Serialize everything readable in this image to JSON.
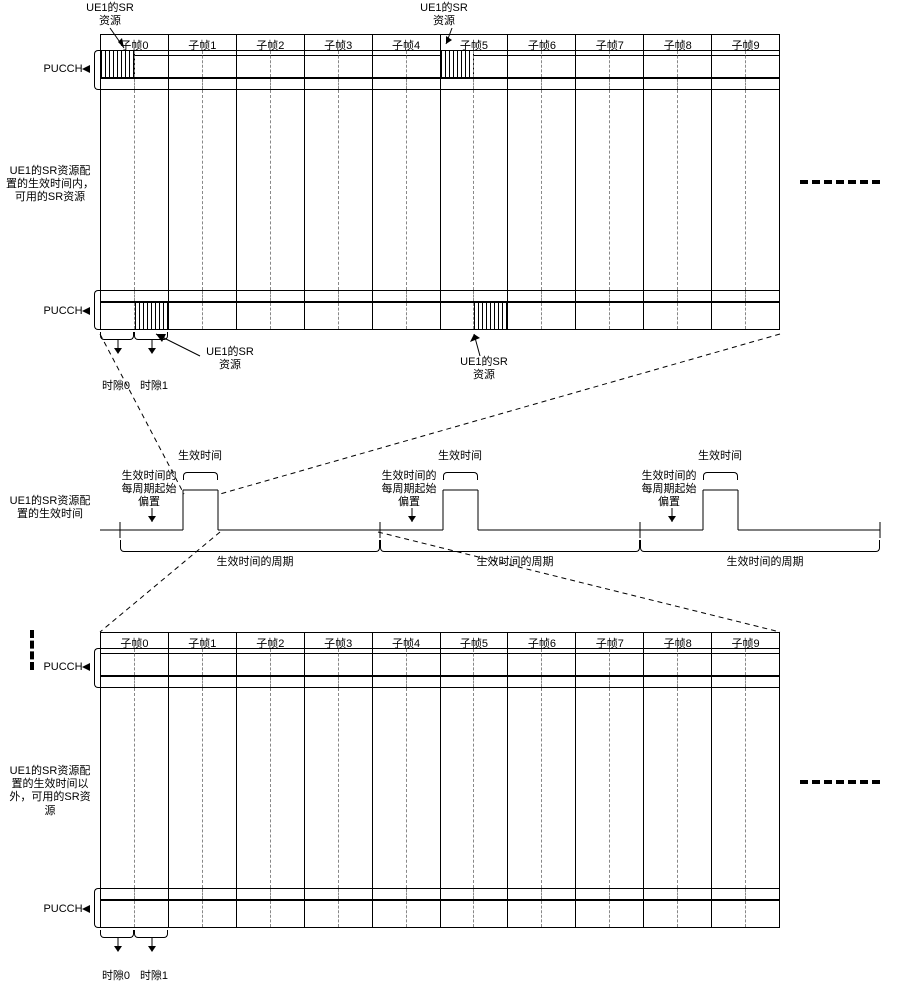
{
  "subframes": [
    "子帧0",
    "子帧1",
    "子帧2",
    "子帧3",
    "子帧4",
    "子帧5",
    "子帧6",
    "子帧7",
    "子帧8",
    "子帧9"
  ],
  "labels": {
    "pucch": "PUCCH",
    "ue1_sr_resource": "UE1的SR\n资源",
    "top_desc": "UE1的SR资源配置的生效时间内，可用的SR资源",
    "bottom_desc": "UE1的SR资源配置的生效时间以外，可用的SR资源",
    "slot0": "时隙0",
    "slot1": "时隙1",
    "effective_time": "生效时间",
    "offset": "生效时间的每周期起始偏置",
    "period": "生效时间的周期",
    "timeline_desc": "UE1的SR资源配置的生效时间"
  }
}
